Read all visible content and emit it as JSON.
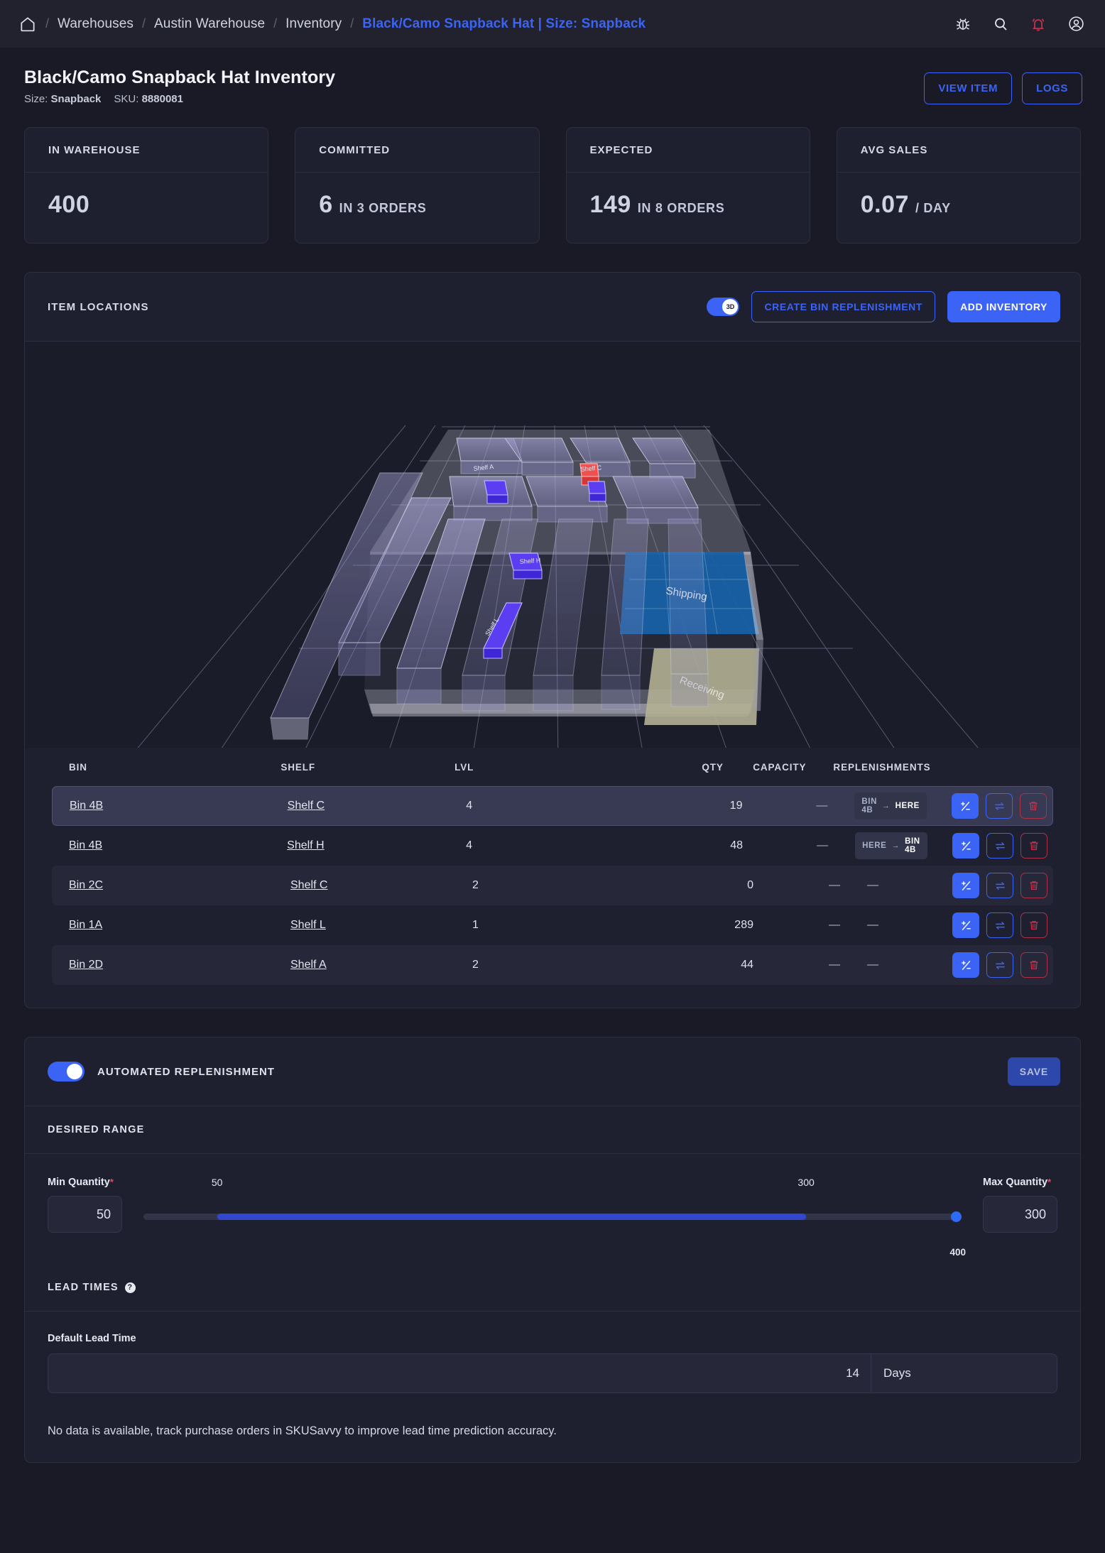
{
  "nav": {
    "home_icon": "home-icon",
    "crumbs": [
      {
        "label": "Warehouses",
        "active": false
      },
      {
        "label": "Austin Warehouse",
        "active": false
      },
      {
        "label": "Inventory",
        "active": false
      },
      {
        "label": "Black/Camo Snapback Hat | Size: Snapback",
        "active": true
      }
    ],
    "separator": "/",
    "icons": [
      "bug-icon",
      "search-icon",
      "bell-icon",
      "account-icon"
    ],
    "bell_color": "#c0334d"
  },
  "page": {
    "title": "Black/Camo Snapback Hat Inventory",
    "size_label": "Size:",
    "size_value": "Snapback",
    "sku_label": "SKU:",
    "sku_value": "8880081",
    "view_item_label": "VIEW ITEM",
    "logs_label": "LOGS"
  },
  "stats": [
    {
      "title": "IN WAREHOUSE",
      "value": "400",
      "unit": ""
    },
    {
      "title": "COMMITTED",
      "value": "6",
      "unit": "IN 3 ORDERS"
    },
    {
      "title": "EXPECTED",
      "value": "149",
      "unit": "IN 8 ORDERS"
    },
    {
      "title": "AVG SALES",
      "value": "0.07",
      "unit": "/ DAY"
    }
  ],
  "locations": {
    "panel_title": "ITEM LOCATIONS",
    "toggle_3d_label": "3D",
    "toggle_3d_on": true,
    "create_bin_replenishment_label": "CREATE BIN REPLENISHMENT",
    "add_inventory_label": "ADD INVENTORY",
    "viz": {
      "shipping_label": "Shipping",
      "receiving_label": "Receiving",
      "shelf_labels": [
        "Shelf A",
        "Shelf C",
        "Shelf H",
        "Shelf L"
      ]
    },
    "columns": [
      "BIN",
      "SHELF",
      "LVL",
      "QTY",
      "CAPACITY",
      "REPLENISHMENTS"
    ],
    "rows": [
      {
        "bin": "Bin 4B",
        "shelf": "Shelf C",
        "lvl": "4",
        "qty": "19",
        "capacity": "—",
        "replenishment": {
          "from": "BIN 4B",
          "to": "HERE"
        },
        "selected": true,
        "alt": false
      },
      {
        "bin": "Bin 4B",
        "shelf": "Shelf H",
        "lvl": "4",
        "qty": "48",
        "capacity": "—",
        "replenishment": {
          "from": "HERE",
          "to": "BIN 4B"
        },
        "selected": false,
        "alt": false
      },
      {
        "bin": "Bin 2C",
        "shelf": "Shelf C",
        "lvl": "2",
        "qty": "0",
        "capacity": "—",
        "replenishment": null,
        "rep_dash": "—",
        "selected": false,
        "alt": true
      },
      {
        "bin": "Bin 1A",
        "shelf": "Shelf L",
        "lvl": "1",
        "qty": "289",
        "capacity": "—",
        "replenishment": null,
        "rep_dash": "—",
        "selected": false,
        "alt": false
      },
      {
        "bin": "Bin 2D",
        "shelf": "Shelf A",
        "lvl": "2",
        "qty": "44",
        "capacity": "—",
        "replenishment": null,
        "rep_dash": "—",
        "selected": false,
        "alt": true
      }
    ],
    "row_actions": [
      "adjust-quantity-icon",
      "transfer-icon",
      "delete-icon"
    ]
  },
  "replenishment": {
    "toggle_on": true,
    "toggle_label": "AUTOMATED REPLENISHMENT",
    "save_label": "SAVE",
    "desired_range_title": "DESIRED RANGE",
    "min_label": "Min Quantity",
    "min_value": "50",
    "max_label": "Max Quantity",
    "max_value": "300",
    "required_mark": "*",
    "slider": {
      "low_mark": "50",
      "high_mark": "300",
      "end_mark": "400"
    },
    "lead_times_title": "LEAD TIMES",
    "lead_times_help": "?",
    "default_lead_time_label": "Default Lead Time",
    "default_lead_time_value": "14",
    "default_lead_time_unit": "Days",
    "note": "No data is available, track purchase orders in SKUSavvy to improve lead time prediction accuracy."
  }
}
